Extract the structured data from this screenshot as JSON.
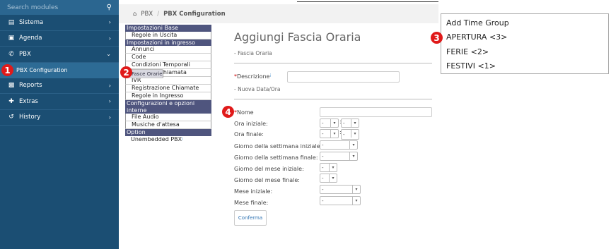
{
  "sidebar": {
    "search_placeholder": "Search modules",
    "items": [
      {
        "label": "Sistema"
      },
      {
        "label": "Agenda"
      },
      {
        "label": "PBX"
      },
      {
        "label": "PBX Configuration"
      },
      {
        "label": "Reports"
      },
      {
        "label": "Extras"
      },
      {
        "label": "History"
      }
    ]
  },
  "breadcrumb": {
    "root": "PBX",
    "sep": "/",
    "current": "PBX Configuration"
  },
  "menu": {
    "h1": "Impostazioni Base",
    "i1": "Regole in Uscita",
    "h2": "Impostazioni in ingresso",
    "i2": "Annunci",
    "i3": "Code",
    "i4": "Condizioni Temporali",
    "i5": "Fasce Orarie",
    "i6": "Gruppi di Chiamata",
    "i7": "IVR",
    "i8": "Registrazione Chiamate",
    "i9": "Regole in Ingresso",
    "h3": "Configurazioni e opzioni interne",
    "i10": "File Audio",
    "i11": "Musiche d'attesa",
    "h4": "Option",
    "i12": "Unembedded PBX",
    "info": "i"
  },
  "form": {
    "title": "Aggiungi Fascia Oraria",
    "section1": "- Fascia Oraria",
    "req_mark": "*",
    "descrizione": "Descrizione",
    "section2": "- Nuova Data/Ora",
    "nome": "Nome",
    "ora_iniziale": "Ora iniziale:",
    "ora_finale": "Ora finale:",
    "giorno_sett_iniziale": "Giorno della settimana iniziale:",
    "giorno_sett_finale": "Giorno della settimana finale:",
    "giorno_mese_iniziale": "Giorno del mese iniziale:",
    "giorno_mese_finale": "Giorno del mese finale:",
    "mese_iniziale": "Mese iniziale:",
    "mese_finale": "Mese finale:",
    "select_value": "-",
    "colon": ":",
    "submit": "Conferma"
  },
  "popup": {
    "items": [
      "Add Time Group",
      "APERTURA <3>",
      "FERIE <2>",
      "FESTIVI <1>"
    ]
  },
  "badges": {
    "b1": "1",
    "b2": "2",
    "b3": "3",
    "b4": "4"
  },
  "colors": {
    "sidebar": "#1b4e73",
    "badge": "#e01a1a",
    "menu_header": "#4f557e"
  }
}
